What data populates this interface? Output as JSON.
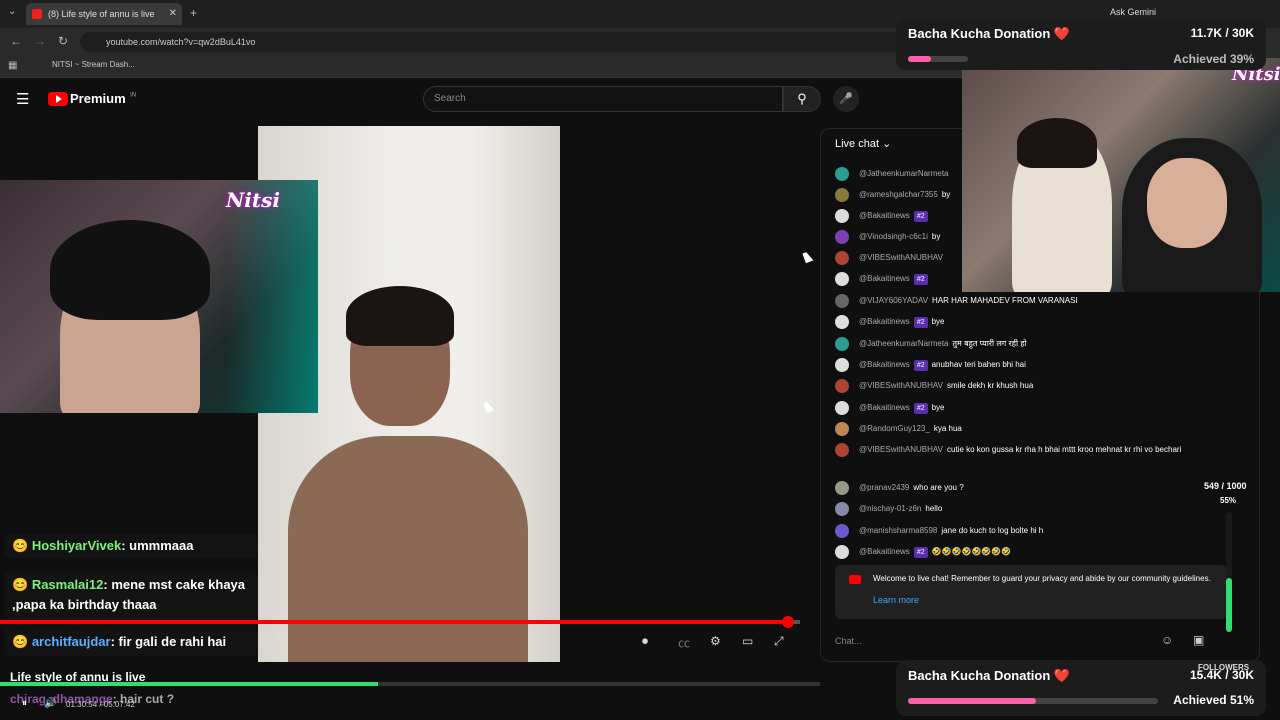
{
  "browser": {
    "tab_title": "(8) Life style of annu is live",
    "url": "youtube.com/watch?v=qw2dBuL41vo",
    "bookmark": "NITSI ~ Stream Dash...",
    "ask_gemini": "Ask Gemini"
  },
  "youtube": {
    "brand": "Premium",
    "brand_sup": "IN",
    "search_placeholder": "Search"
  },
  "overlay_chat": [
    {
      "name": "HoshiyarVivek",
      "text": ": ummmaaa"
    },
    {
      "name": "Rasmalai12",
      "text": ": mene mst cake khaya ,papa ka birthday thaaa"
    },
    {
      "name": "architfaujdar",
      "text": ": fir gali de rahi hai"
    },
    {
      "name": "chirag_dhamange",
      "text": ": hair cut ?"
    }
  ],
  "stream_title": "Life style of annu is live",
  "player_time": "01:30:54 / 05:07:42",
  "live_chat": {
    "header": "Live chat",
    "messages": [
      {
        "user": "@JatheenkumarNarmeta",
        "text": "",
        "badge": "",
        "color": "#2a9d8f"
      },
      {
        "user": "@rameshgalchar7355",
        "text": "by",
        "badge": "",
        "color": "#8a7a3a"
      },
      {
        "user": "@Bakaitinews",
        "text": "",
        "badge": "#2",
        "color": "#ddd"
      },
      {
        "user": "@Vinodsingh-c6c1i",
        "text": "by",
        "badge": "",
        "color": "#7b3fb2"
      },
      {
        "user": "@VIBESwithANUBHAV",
        "text": "",
        "badge": "",
        "color": "#a43"
      },
      {
        "user": "@Bakaitinews",
        "text": "",
        "badge": "#2",
        "color": "#ddd"
      },
      {
        "user": "@VIJAY606YADAV",
        "text": "HAR HAR MAHADEV FROM VARANASI",
        "badge": "",
        "color": "#666"
      },
      {
        "user": "@Bakaitinews",
        "text": "bye",
        "badge": "#2",
        "color": "#ddd"
      },
      {
        "user": "@JatheenkumarNarmeta",
        "text": "तुम बहुत प्यारी लग रही हो",
        "badge": "",
        "color": "#2a9d8f"
      },
      {
        "user": "@Bakaitinews",
        "text": "anubhav teri bahen bhi hai",
        "badge": "#2",
        "color": "#ddd"
      },
      {
        "user": "@VIBESwithANUBHAV",
        "text": "smile dekh kr khush hua",
        "badge": "",
        "color": "#a43"
      },
      {
        "user": "@Bakaitinews",
        "text": "bye",
        "badge": "#2",
        "color": "#ddd"
      },
      {
        "user": "@RandomGuy123_",
        "text": "kya hua",
        "badge": "",
        "color": "#b85"
      },
      {
        "user": "@VIBESwithANUBHAV",
        "text": "cutie ko kon gussa kr rha h bhai mttt kroo mehnat kr rhi vo bechari",
        "badge": "",
        "color": "#a43"
      },
      {
        "user": "@pranav2439",
        "text": "who are you ?",
        "badge": "",
        "color": "#998"
      },
      {
        "user": "@nischay-01-z6n",
        "text": "hello",
        "badge": "",
        "color": "#88a"
      },
      {
        "user": "@manishsharma8598",
        "text": "jane do kuch to log bolte hi h",
        "badge": "",
        "color": "#6a5acd"
      },
      {
        "user": "@Bakaitinews",
        "text": "🤣🤣🤣🤣🤣🤣🤣🤣",
        "badge": "#2",
        "color": "#ddd"
      }
    ],
    "welcome": "Welcome to live chat! Remember to guard your privacy and abide by our community guidelines.",
    "learn_more": "Learn more",
    "input_placeholder": "Chat..."
  },
  "donation_top": {
    "title": "Bacha Kucha Donation ❤️",
    "amount": "11.7K / 30K",
    "achieved": "Achieved 39%",
    "progress": 0.39
  },
  "donation_bottom": {
    "title": "Bacha Kucha Donation ❤️",
    "amount": "15.4K / 30K",
    "achieved": "Achieved 51%",
    "progress": 0.51
  },
  "followers": {
    "count": "549 / 1000",
    "percent": "55%",
    "label": "FOLLOWERS",
    "progress": 0.55
  },
  "cam_logo": "Nitsi",
  "video_progress": 0.99,
  "stream_progress": 0.46
}
